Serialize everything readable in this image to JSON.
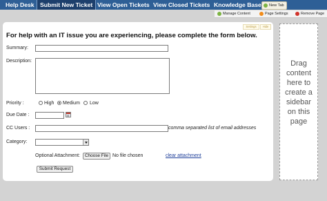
{
  "nav": {
    "tabs": [
      {
        "label": "Help Desk"
      },
      {
        "label": "Submit New Ticket"
      },
      {
        "label": "View Open Tickets"
      },
      {
        "label": "View Closed Tickets"
      },
      {
        "label": "Knowledge Base"
      }
    ],
    "new_tab_label": "New Tab"
  },
  "toolbar": {
    "manage_content": "Manage Content",
    "page_settings": "Page Settings",
    "remove_page": "Remove Page"
  },
  "panel": {
    "corner_buttons": [
      "Settings",
      "Hide"
    ]
  },
  "form": {
    "heading": "For help with an IT issue you are experiencing, please complete the form below.",
    "summary_label": "Summary:",
    "summary_value": "",
    "description_label": "Description:",
    "description_value": "",
    "priority_label": "Priority :",
    "priority_options": [
      "High",
      "Medium",
      "Low"
    ],
    "priority_selected": "Medium",
    "due_date_label": "Due Date :",
    "due_date_value": "",
    "cc_users_label": "CC Users :",
    "cc_users_value": "",
    "cc_users_hint": "comma separated list of email addresses",
    "category_label": "Category:",
    "category_value": "",
    "attachment_label": "Optional Attachment:",
    "choose_file_label": "Choose File",
    "file_status": "No file chosen",
    "clear_attachment_label": "clear attachment",
    "submit_label": "Submit Request"
  },
  "sidebar": {
    "drop_text": "Drag content here to create a sidebar on this page"
  },
  "colors": {
    "nav_background": "#2e5f96",
    "active_tab": "#1d3f6c",
    "page_background": "#d3d3d3",
    "link": "#1f3f9a"
  }
}
